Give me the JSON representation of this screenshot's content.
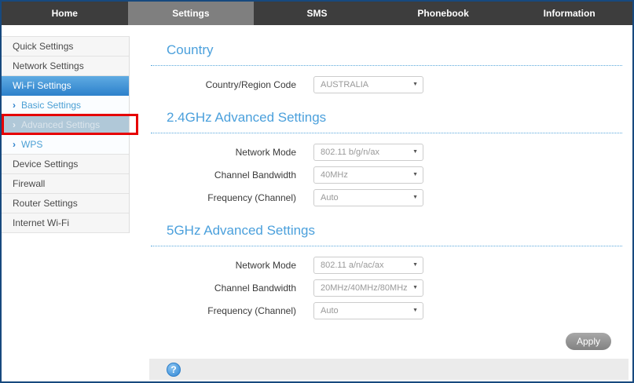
{
  "nav": {
    "tabs": [
      {
        "label": "Home"
      },
      {
        "label": "Settings",
        "active": true
      },
      {
        "label": "SMS"
      },
      {
        "label": "Phonebook"
      },
      {
        "label": "Information"
      }
    ]
  },
  "sidebar": {
    "items": [
      {
        "label": "Quick Settings"
      },
      {
        "label": "Network Settings"
      },
      {
        "label": "Wi-Fi Settings",
        "state": "active-parent"
      },
      {
        "label": "Basic Settings",
        "sub": true
      },
      {
        "label": "Advanced Settings",
        "sub": true,
        "state": "selected",
        "annotated": "red-box"
      },
      {
        "label": "WPS",
        "sub": true
      },
      {
        "label": "Device Settings"
      },
      {
        "label": "Firewall"
      },
      {
        "label": "Router Settings"
      },
      {
        "label": "Internet Wi-Fi"
      }
    ]
  },
  "main": {
    "sections": [
      {
        "title": "Country",
        "rows": [
          {
            "label": "Country/Region Code",
            "value": "AUSTRALIA"
          }
        ]
      },
      {
        "title": "2.4GHz Advanced Settings",
        "rows": [
          {
            "label": "Network Mode",
            "value": "802.11 b/g/n/ax"
          },
          {
            "label": "Channel Bandwidth",
            "value": "40MHz"
          },
          {
            "label": "Frequency (Channel)",
            "value": "Auto"
          }
        ]
      },
      {
        "title": "5GHz Advanced Settings",
        "rows": [
          {
            "label": "Network Mode",
            "value": "802.11 a/n/ac/ax"
          },
          {
            "label": "Channel Bandwidth",
            "value": "20MHz/40MHz/80MHz"
          },
          {
            "label": "Frequency (Channel)",
            "value": "Auto"
          }
        ]
      }
    ],
    "apply_label": "Apply"
  },
  "icons": {
    "chevron_right": "›",
    "dropdown_arrow": "▼",
    "help": "?"
  },
  "colors": {
    "accent_blue": "#4ba0dc",
    "nav_bg": "#3d3d3d",
    "nav_active_bg": "#7f7f7f",
    "sidebar_active_top": "#5fabe2",
    "sidebar_active_bottom": "#2e82cc",
    "annotation_red": "#e60000",
    "footer_bg": "#ebebeb",
    "page_border": "#17497e"
  }
}
